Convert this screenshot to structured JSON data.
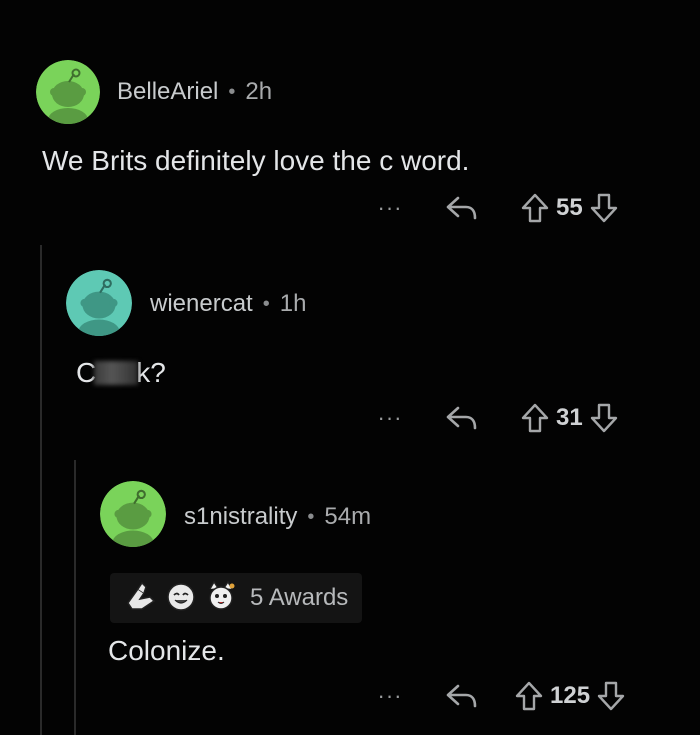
{
  "comments": [
    {
      "username": "BelleAriel",
      "separator": "•",
      "time": "2h",
      "body": "We Brits definitely love the c word.",
      "more": "···",
      "score": "55",
      "avatar_color": "#7ad35a"
    },
    {
      "username": "wienercat",
      "separator": "•",
      "time": "1h",
      "body_prefix": "C",
      "body_suffix": "k?",
      "more": "···",
      "score": "31",
      "avatar_color": "#5ec9b4"
    },
    {
      "username": "s1nistrality",
      "separator": "•",
      "time": "54m",
      "awards_label": "5 Awards",
      "body": "Colonize.",
      "more": "···",
      "score": "125",
      "avatar_color": "#7ad35a"
    }
  ],
  "icons": {
    "reply": "reply-arrow-icon",
    "upvote": "upvote-arrow-icon",
    "downvote": "downvote-arrow-icon",
    "avatar": "snoo-avatar-icon"
  },
  "colors": {
    "background": "#030303",
    "text": "#e4e6e8",
    "muted": "#a5a7a9",
    "thread_line": "#2a2a2a"
  }
}
